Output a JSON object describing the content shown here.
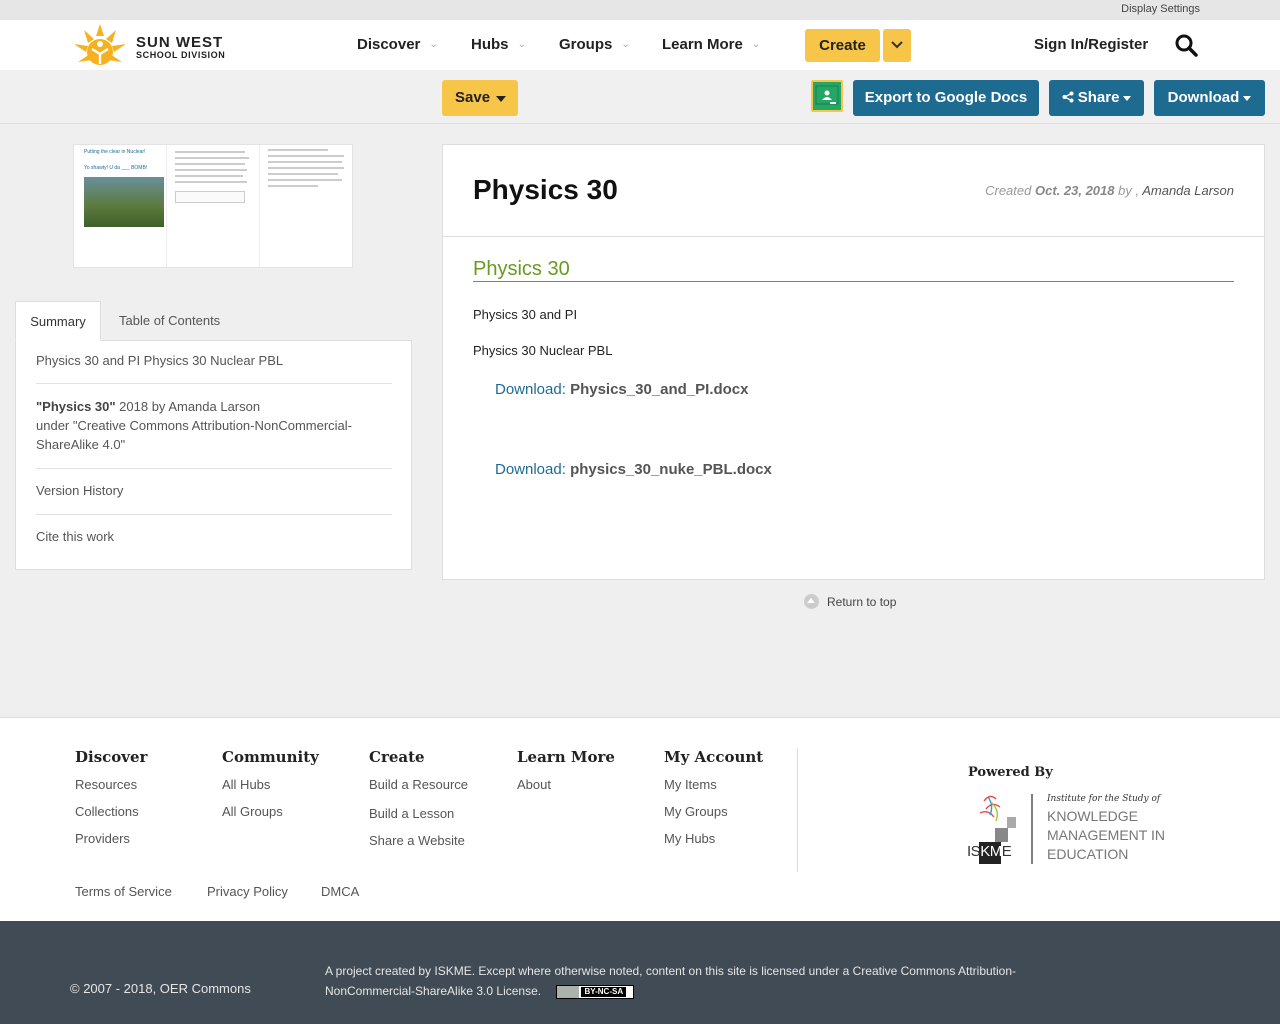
{
  "display_settings": "Display Settings",
  "logo": {
    "line1": "SUN WEST",
    "line2": "SCHOOL DIVISION"
  },
  "nav": {
    "discover": "Discover",
    "hubs": "Hubs",
    "groups": "Groups",
    "learn_more": "Learn More",
    "create": "Create",
    "sign_in": "Sign In/Register"
  },
  "toolbar": {
    "save": "Save",
    "export": "Export to Google Docs",
    "share": "Share",
    "download": "Download"
  },
  "thumbnail": {
    "caption1": "Putting the clear in Nuclear!",
    "caption2": "Yo shawty! U da ___ BOMB!"
  },
  "tabs": {
    "summary": "Summary",
    "toc": "Table of Contents"
  },
  "sidebar": {
    "summary_text": "Physics 30 and PI Physics 30 Nuclear PBL",
    "citation_title": "\"Physics 30\"",
    "citation_rest": " 2018 by Amanda Larson",
    "license_line": "under \"Creative Commons Attribution-NonCommercial-ShareAlike 4.0\"",
    "version_history": "Version History",
    "cite": "Cite this work"
  },
  "resource": {
    "title": "Physics 30",
    "created_label": "Created",
    "created_date": "Oct. 23, 2018",
    "by": "by ,",
    "author": "Amanda Larson",
    "section_title": "Physics 30",
    "para1": "Physics 30 and PI",
    "para2": "Physics 30 Nuclear PBL",
    "downloads": [
      {
        "label": "Download:",
        "file": "Physics_30_and_PI.docx"
      },
      {
        "label": "Download:",
        "file": "physics_30_nuke_PBL.docx"
      }
    ]
  },
  "return_top": "Return to top",
  "footer": {
    "discover": {
      "head": "Discover",
      "links": [
        "Resources",
        "Collections",
        "Providers"
      ]
    },
    "community": {
      "head": "Community",
      "links": [
        "All Hubs",
        "All Groups"
      ]
    },
    "create": {
      "head": "Create",
      "links": [
        "Build a Resource",
        "Build a Lesson",
        "Share a Website"
      ]
    },
    "learn_more": {
      "head": "Learn More",
      "links": [
        "About"
      ]
    },
    "my_account": {
      "head": "My Account",
      "links": [
        "My Items",
        "My Groups",
        "My Hubs"
      ]
    },
    "powered_by": "Powered By",
    "iskme": {
      "line0": "Institute for the Study of",
      "line1": "KNOWLEDGE",
      "line2": "MANAGEMENT IN",
      "line3": "EDUCATION",
      "abbr_a": "IS",
      "abbr_b": "KM",
      "abbr_c": "E"
    },
    "legal": [
      "Terms of Service",
      "Privacy Policy",
      "DMCA"
    ]
  },
  "bottom": {
    "copyright": "© 2007 - 2018, OER Commons",
    "project": "A project created by ISKME. Except where otherwise noted, content on this site is licensed under a Creative Commons Attribution-NonCommercial-ShareAlike 3.0 License.",
    "badge": "BY-NC-SA"
  },
  "colors": {
    "accent_yellow": "#f7c548",
    "brand_blue": "#1e6b91",
    "heading_green": "#6a9a22",
    "footer_dark": "#414b56"
  }
}
